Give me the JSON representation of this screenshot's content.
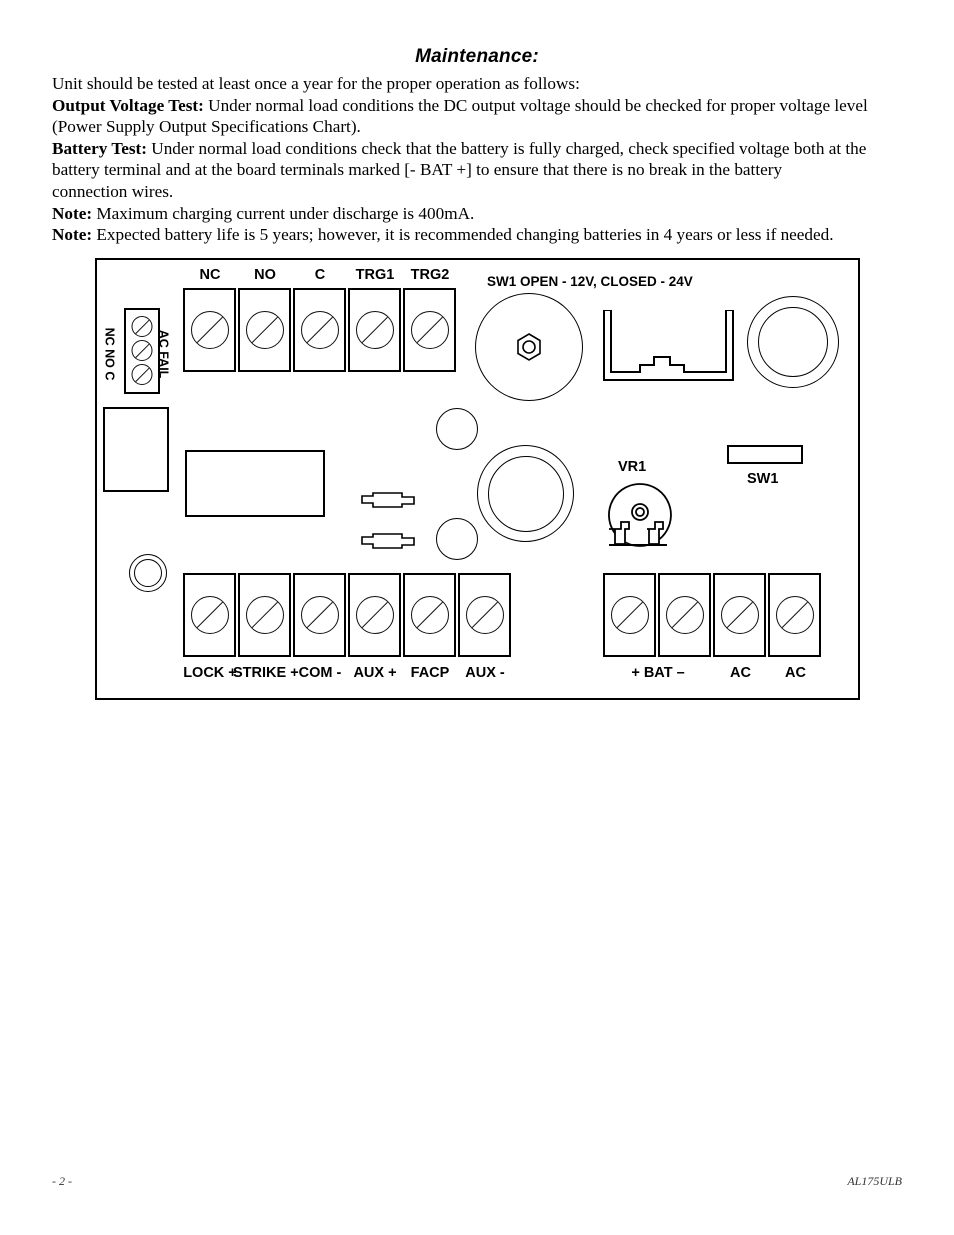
{
  "document": {
    "heading": "Maintenance:",
    "paragraphs": [
      {
        "lead": "",
        "text": "Unit should be tested at least once a year for the proper operation as follows:"
      },
      {
        "lead": "Output Voltage Test:",
        "text": " Under normal load conditions the DC output voltage should be checked for proper voltage level"
      },
      {
        "lead": "",
        "text": "(Power Supply Output Specifications Chart)."
      },
      {
        "lead": "Battery Test:",
        "text": " Under normal load conditions check that the battery is fully charged, check specified voltage both at the"
      },
      {
        "lead": "",
        "text": "battery terminal and at the board terminals marked [- BAT +] to ensure that there is no break in the battery"
      },
      {
        "lead": "",
        "text": "connection wires."
      },
      {
        "lead": "Note:",
        "text": " Maximum charging current under discharge is 400mA."
      },
      {
        "lead": "Note:",
        "text": " Expected battery life is 5 years; however, it is recommended changing batteries in 4 years or less if needed."
      }
    ]
  },
  "board": {
    "top_terminal_labels": [
      "NC",
      "NO",
      "C",
      "TRG1",
      "TRG2"
    ],
    "bottom_left_terminal_labels": [
      "LOCK +",
      "STRIKE +",
      "COM -",
      "AUX +",
      "FACP",
      "AUX -"
    ],
    "bottom_right_terminal_labels": [
      "+ BAT –",
      "AC",
      "AC"
    ],
    "ac_fail": {
      "block_label": "AC FAIL",
      "pin_labels": "NC NO  C"
    },
    "sw1_note": "SW1 OPEN - 12V, CLOSED - 24V",
    "vr1_label": "VR1",
    "sw1_label": "SW1"
  },
  "footer": {
    "page": "- 2 -",
    "code": "AL175ULB"
  }
}
